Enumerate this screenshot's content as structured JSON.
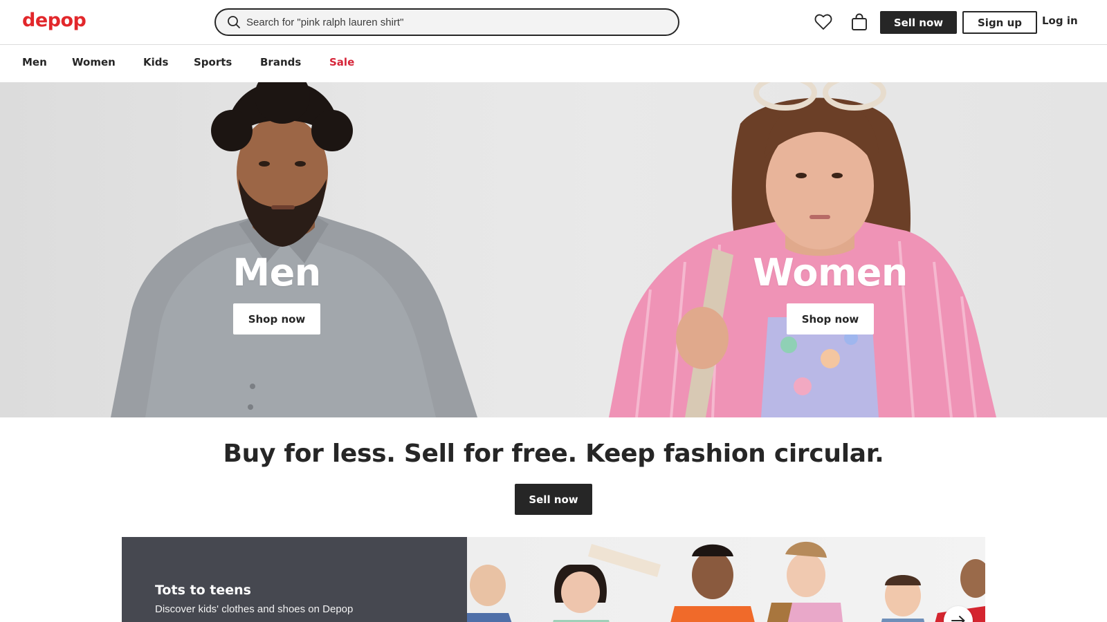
{
  "header": {
    "logo": "depop",
    "search_placeholder": "Search for \"pink ralph lauren shirt\"",
    "sell_label": "Sell now",
    "signup_label": "Sign up",
    "login_label": "Log in",
    "icons": [
      "search-icon",
      "heart-icon",
      "bag-icon"
    ]
  },
  "nav": {
    "items": [
      {
        "label": "Men"
      },
      {
        "label": "Women"
      },
      {
        "label": "Kids"
      },
      {
        "label": "Sports"
      },
      {
        "label": "Brands"
      },
      {
        "label": "Sale"
      }
    ]
  },
  "hero": {
    "men": {
      "title": "Men",
      "cta": "Shop now"
    },
    "women": {
      "title": "Women",
      "cta": "Shop now"
    }
  },
  "tagline": {
    "text": "Buy for less. Sell for free. Keep fashion circular.",
    "cta": "Sell now"
  },
  "kids_banner": {
    "title": "Tots to teens",
    "subtitle": "Discover kids' clothes and shoes on Depop"
  },
  "colors": {
    "brand": "#e2272b",
    "sale": "#d6263a",
    "dark": "#262626",
    "kids_panel": "#464850"
  }
}
